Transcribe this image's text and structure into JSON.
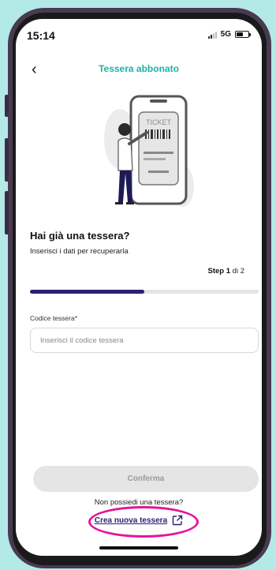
{
  "status_bar": {
    "time": "15:14",
    "network": "5G"
  },
  "header": {
    "back_icon": "chevron-left-icon",
    "title": "Tessera abbonato"
  },
  "illustration": {
    "ticket_text": "TICKET"
  },
  "content": {
    "heading": "Hai già una tessera?",
    "subtitle": "Inserisci i dati per recuperarla",
    "step_prefix": "Step 1",
    "step_suffix": " di 2",
    "progress": 0.5
  },
  "form": {
    "label": "Codice tessera*",
    "placeholder": "Inserisci il codice tessera",
    "value": ""
  },
  "actions": {
    "confirm_label": "Conferma",
    "no_card_text": "Non possiedi una tessera?",
    "create_label": "Crea nuova tessera",
    "create_icon": "external-link-icon"
  },
  "colors": {
    "accent": "#1bb3a6",
    "primary": "#2d1e70",
    "highlight": "#e5139a",
    "background": "#b3eae8"
  }
}
